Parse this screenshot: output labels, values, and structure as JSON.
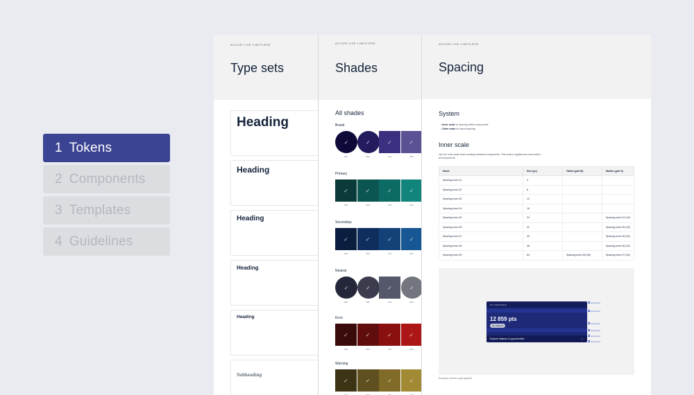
{
  "nav": [
    {
      "num": "1",
      "label": "Tokens",
      "active": true
    },
    {
      "num": "2",
      "label": "Components",
      "active": false
    },
    {
      "num": "3",
      "label": "Templates",
      "active": false
    },
    {
      "num": "4",
      "label": "Guidelines",
      "active": false
    }
  ],
  "type_panel": {
    "brand": "ACCOR LIVE LIMITLESS",
    "title": "Type sets",
    "samples": [
      "Heading",
      "Heading",
      "Heading",
      "Heading",
      "Heading",
      "Subheading"
    ]
  },
  "shades_panel": {
    "brand": "ACCOR LIVE LIMITLESS",
    "title": "Shades",
    "subtitle": "All shades",
    "groups": [
      {
        "name": "Brand",
        "shape": "circle",
        "colors": [
          "#0d0a3a",
          "#221c5e",
          "#3b2f80",
          "#5a5294"
        ],
        "codes": [
          "900",
          "800",
          "700",
          "600"
        ]
      },
      {
        "name": "Primary",
        "shape": "square",
        "colors": [
          "#0a3a3a",
          "#0b5552",
          "#0d6b65",
          "#11857c"
        ],
        "codes": [
          "900",
          "800",
          "700",
          "600"
        ]
      },
      {
        "name": "Secondary",
        "shape": "square",
        "colors": [
          "#0c1e3f",
          "#0f2e5e",
          "#134279",
          "#175793"
        ],
        "codes": [
          "900",
          "800",
          "700",
          "600"
        ]
      },
      {
        "name": "Neutral",
        "shape": "circle",
        "colors": [
          "#24263a",
          "#3b3d4e",
          "#55576a",
          "#74767f"
        ],
        "codes": [
          "900",
          "800",
          "700",
          "600"
        ]
      },
      {
        "name": "Error",
        "shape": "square",
        "colors": [
          "#3b0b0b",
          "#610d0d",
          "#8a1010",
          "#ad1616"
        ],
        "codes": [
          "900",
          "800",
          "700",
          "600"
        ]
      },
      {
        "name": "Warning",
        "shape": "square",
        "colors": [
          "#3c3414",
          "#5f5020",
          "#806c28",
          "#a28933"
        ],
        "codes": [
          "900",
          "800",
          "700",
          "600"
        ]
      }
    ]
  },
  "spacing_panel": {
    "brand": "ACCOR LIVE LIMITLESS",
    "title": "Spacing",
    "system_title": "System",
    "bullets": [
      {
        "bold": "Inner scale",
        "text": " for spacing within components"
      },
      {
        "bold": "Outer scale",
        "text": " for layout spacing"
      }
    ],
    "inner_title": "Inner scale",
    "inner_desc": "Use the inner scale when building individual components. This scale is applied and used within all components.",
    "table": {
      "headers": [
        "Name",
        "Size (px)",
        "Tablet (grid M)",
        "Mobile (grid S)"
      ],
      "rows": [
        [
          "Spacing-inner-01",
          "4",
          "",
          ""
        ],
        [
          "Spacing-inner-02",
          "8",
          "",
          ""
        ],
        [
          "Spacing-inner-03",
          "12",
          "",
          ""
        ],
        [
          "Spacing-inner-04",
          "16",
          "",
          ""
        ],
        [
          "Spacing-inner-05",
          "24",
          "",
          "Spacing-inner-04 (16)"
        ],
        [
          "Spacing-inner-06",
          "32",
          "",
          "Spacing-inner-05 (24)"
        ],
        [
          "Spacing-inner-07",
          "40",
          "",
          "Spacing-inner-06 (32)"
        ],
        [
          "Spacing-inner-08",
          "48",
          "",
          "Spacing-inner-06 (32)"
        ],
        [
          "Spacing-inner-09",
          "64",
          "Spacing-inner-08 (48)",
          "Spacing-inner-07 (40)"
        ]
      ]
    },
    "example": {
      "card_label": "MY REWARDS",
      "points": "12 859 pts",
      "badge": "ALL MEALS",
      "link": "Explore balance & opportunities",
      "arrow": "→",
      "annotations": [
        "spacing-04",
        "spacing-04",
        "spacing-01",
        "spacing-03",
        "spacing-04",
        "spacing-04"
      ],
      "caption": "Example of inner scale applied"
    }
  }
}
